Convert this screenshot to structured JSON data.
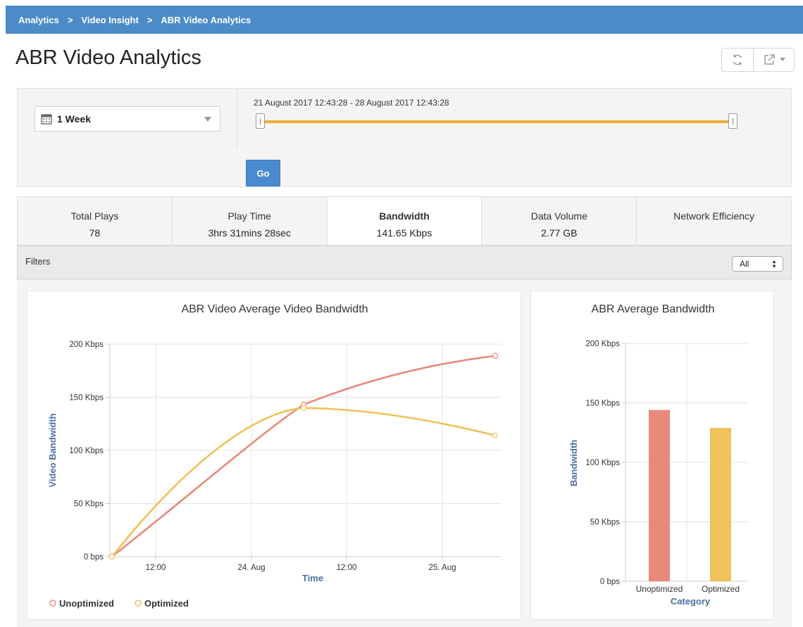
{
  "breadcrumb": {
    "items": [
      "Analytics",
      "Video Insight",
      "ABR Video Analytics"
    ],
    "separator": ">"
  },
  "page": {
    "title": "ABR Video Analytics"
  },
  "tools": {
    "refresh_icon": "refresh-icon",
    "export_icon": "export-icon"
  },
  "range": {
    "period_label": "1 Week",
    "range_text": "21 August 2017 12:43:28 - 28 August 2017 12:43:28",
    "go_label": "Go",
    "slider_start": 0,
    "slider_end": 1
  },
  "metrics": [
    {
      "label": "Total Plays",
      "value": "78",
      "active": false
    },
    {
      "label": "Play Time",
      "value": "3hrs 31mins 28sec",
      "active": false
    },
    {
      "label": "Bandwidth",
      "value": "141.65 Kbps",
      "active": true
    },
    {
      "label": "Data Volume",
      "value": "2.77 GB",
      "active": false
    },
    {
      "label": "Network Efficiency",
      "value": "",
      "active": false
    }
  ],
  "filters": {
    "label": "Filters",
    "selected": "All"
  },
  "colors": {
    "accent": "#4c8bc7",
    "unoptimized": "#e8897a",
    "optimized": "#f0c25a",
    "axis_title": "#4a6fa5",
    "slider": "#f0ad38"
  },
  "chart_data": [
    {
      "type": "line",
      "title": "ABR Video Average Video Bandwidth",
      "xlabel": "Time",
      "ylabel": "Video Bandwidth",
      "ylim": [
        0,
        200
      ],
      "yticks": [
        "0 bps",
        "50 Kbps",
        "100 Kbps",
        "150 Kbps",
        "200 Kbps"
      ],
      "xtick_labels": [
        "12:00",
        "24. Aug",
        "12:00",
        "25. Aug"
      ],
      "x": [
        "23. Aug 06:00",
        "24. Aug 06:00",
        "25. Aug 06:00"
      ],
      "series": [
        {
          "name": "Unoptimized",
          "values": [
            0,
            143,
            189
          ]
        },
        {
          "name": "Optimized",
          "values": [
            0,
            140,
            114
          ]
        }
      ],
      "legend": "bottom-left",
      "grid": true
    },
    {
      "type": "bar",
      "title": "ABR Average Bandwidth",
      "xlabel": "Category",
      "ylabel": "Bandwidth",
      "ylim": [
        0,
        200
      ],
      "yticks": [
        "0 bps",
        "50 Kbps",
        "100 Kbps",
        "150 Kbps",
        "200 Kbps"
      ],
      "categories": [
        "Unoptimized",
        "Optimized"
      ],
      "values": [
        144,
        129
      ],
      "grid": true
    }
  ]
}
